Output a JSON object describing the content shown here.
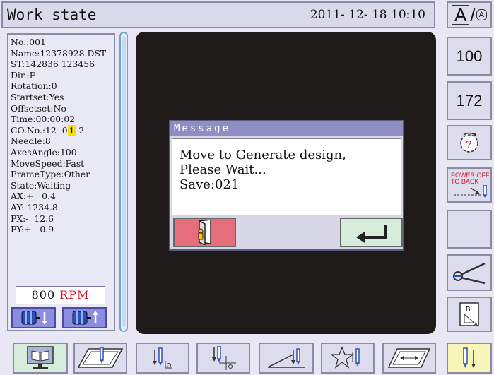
{
  "header": {
    "title": "Work state",
    "datetime": "2011- 12- 18  10:10"
  },
  "info": {
    "no": "No.:001",
    "name": "Name:12378928.DST",
    "st": "ST:142836 123456",
    "dir": "Dir.:F",
    "rotation": "Rotation:0",
    "startset": "Startset:Yes",
    "offsetset": "Offsetset:No",
    "time": "Time:00:00:02",
    "co_prefix": "CO.No.:12  0",
    "co_selected": "1",
    "co_suffix": " 2",
    "needle": "Needle:8",
    "axes_angle": "AxesAngle:100",
    "move_speed": "MoveSpeed:Fast",
    "frame_type": "FrameType:Other",
    "state": "State:Waiting",
    "ax": "AX:+   0.4",
    "ay": "AY:-1234.8",
    "px": "PX:-  12.6",
    "py": "PY:+   0.9"
  },
  "speed": {
    "value": "800",
    "unit": "RPM"
  },
  "dialog": {
    "title": "Message",
    "line1": "Move to Generate design,",
    "line2": "Please Wait...",
    "line3": "Save:021"
  },
  "right_panel": {
    "case_label_big": "A",
    "case_sep": "/",
    "case_label_small": "A",
    "value1": "100",
    "value2": "172",
    "help_glyph": "?",
    "power_off_line1": "POWER OFF",
    "power_off_line2": "TO BACK",
    "b_label": "B",
    "a_label": "A"
  },
  "colors": {
    "accent": "#8e8ec4",
    "highlight": "#f6e200",
    "rpm_unit": "#d0182a",
    "cancel": "#e46f7a",
    "confirm": "#d7eddc"
  },
  "icons": {
    "speed_down": "spool-down-icon",
    "speed_up": "spool-up-icon",
    "cancel": "exit-door-icon",
    "confirm": "enter-arrow-icon",
    "monitor": "monitor-book-icon",
    "frame_needle": "frame-needle-icon",
    "needle_zero": "needle-origin-icon",
    "needle_cross": "needle-cross-icon",
    "needle_slope": "needle-slope-icon",
    "star_needle": "star-needle-icon",
    "frame_outline": "frame-outline-icon",
    "needle_updown": "needle-updown-icon"
  }
}
